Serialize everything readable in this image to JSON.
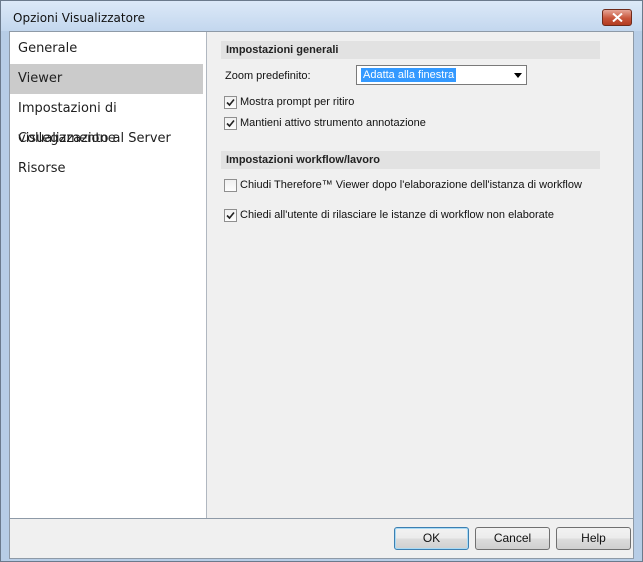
{
  "window": {
    "title": "Opzioni Visualizzatore"
  },
  "sidebar": {
    "items": [
      {
        "label": "Generale",
        "selected": false
      },
      {
        "label": "Viewer",
        "selected": true
      },
      {
        "label": "Impostazioni di visualizzazione",
        "selected": false
      },
      {
        "label": "Collegamento al Server",
        "selected": false
      },
      {
        "label": "Risorse",
        "selected": false
      }
    ]
  },
  "general_settings": {
    "header": "Impostazioni generali",
    "zoom_label": "Zoom predefinito:",
    "zoom_value": "Adatta alla finestra",
    "show_prompt": {
      "label": "Mostra prompt per ritiro",
      "checked": true
    },
    "keep_annotation_tool": {
      "label": "Mantieni attivo strumento annotazione",
      "checked": true
    }
  },
  "workflow_settings": {
    "header": "Impostazioni workflow/lavoro",
    "close_viewer": {
      "label": "Chiudi Therefore™ Viewer dopo l'elaborazione dell'istanza di workflow",
      "checked": false
    },
    "ask_release": {
      "label": "Chiedi all'utente di rilasciare le istanze di workflow non elaborate",
      "checked": true
    }
  },
  "footer": {
    "ok_label": "OK",
    "cancel_label": "Cancel",
    "help_label": "Help"
  },
  "colors": {
    "selection": "#cbcbcb",
    "highlight": "#3399ff",
    "close": "#c8553b"
  }
}
